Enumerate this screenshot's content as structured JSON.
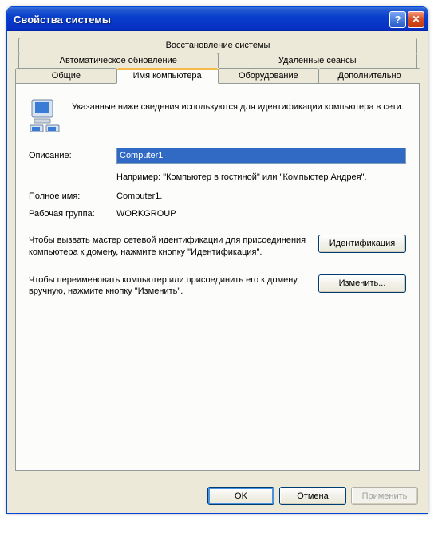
{
  "window": {
    "title": "Свойства системы"
  },
  "tabs": {
    "row1": [
      {
        "label": "Восстановление системы"
      }
    ],
    "row2": [
      {
        "label": "Автоматическое обновление"
      },
      {
        "label": "Удаленные сеансы"
      }
    ],
    "row3": [
      {
        "label": "Общие"
      },
      {
        "label": "Имя компьютера"
      },
      {
        "label": "Оборудование"
      },
      {
        "label": "Дополнительно"
      }
    ]
  },
  "panel": {
    "intro": "Указанные ниже сведения используются для идентификации компьютера в сети.",
    "description_label": "Описание:",
    "description_value": "Computer1",
    "example": "Например: \"Компьютер в гостиной\" или \"Компьютер Андрея\".",
    "fullname_label": "Полное имя:",
    "fullname_value": "Computer1.",
    "workgroup_label": "Рабочая группа:",
    "workgroup_value": "WORKGROUP",
    "identify_text": "Чтобы вызвать мастер сетевой идентификации для присоединения компьютера к домену, нажмите кнопку \"Идентификация\".",
    "identify_button": "Идентификация",
    "change_text": "Чтобы переименовать компьютер или присоединить его к домену вручную, нажмите кнопку \"Изменить\".",
    "change_button": "Изменить..."
  },
  "footer": {
    "ok": "OK",
    "cancel": "Отмена",
    "apply": "Применить"
  }
}
